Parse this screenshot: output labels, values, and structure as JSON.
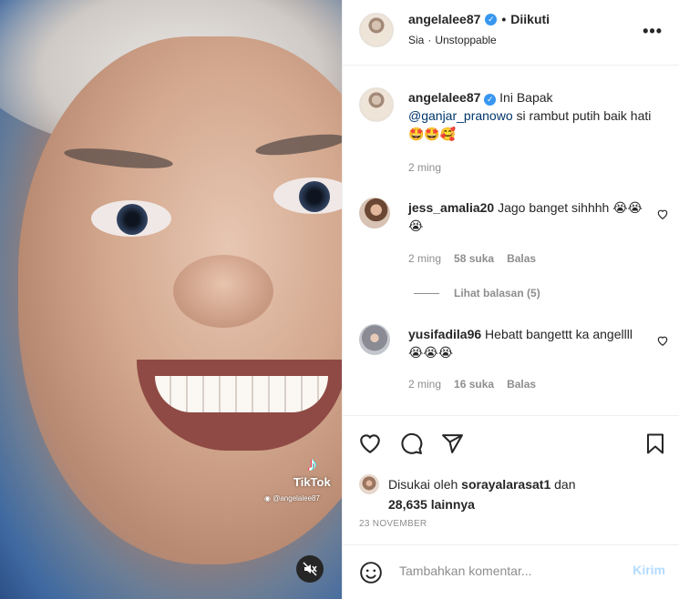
{
  "media": {
    "watermark_brand": "TikTok",
    "watermark_handle": "@angelalee87"
  },
  "header": {
    "username": "angelalee87",
    "separator": "•",
    "follow_status": "Diikuti",
    "subtitle_1": "Sia",
    "subtitle_sep": "·",
    "subtitle_2": "Unstoppable"
  },
  "caption": {
    "username": "angelalee87",
    "text_1": "Ini Bapak",
    "mention": "@ganjar_pranowo",
    "text_2": "si rambut putih baik hati🤩🤩🥰",
    "time": "2 ming"
  },
  "comments": [
    {
      "username": "jess_amalia20",
      "text": "Jago banget sihhhh 😭😭😭",
      "time": "2 ming",
      "likes": "58 suka",
      "reply": "Balas"
    },
    {
      "username": "yusifadila96",
      "text": "Hebatt bangettt ka angellll😭😭😭",
      "time": "2 ming",
      "likes": "16 suka",
      "reply": "Balas"
    }
  ],
  "view_replies": "Lihat balasan (5)",
  "likes": {
    "prefix": "Disukai oleh",
    "user": "sorayalarasat1",
    "and": "dan",
    "count": "28,635 lainnya"
  },
  "date": "23 NOVEMBER",
  "add_comment": {
    "placeholder": "Tambahkan komentar...",
    "post_label": "Kirim"
  },
  "colors": {
    "link": "#00376b",
    "verified": "#3897f0",
    "muted": "#8e8e8e",
    "post_disabled": "#b3dbff"
  }
}
